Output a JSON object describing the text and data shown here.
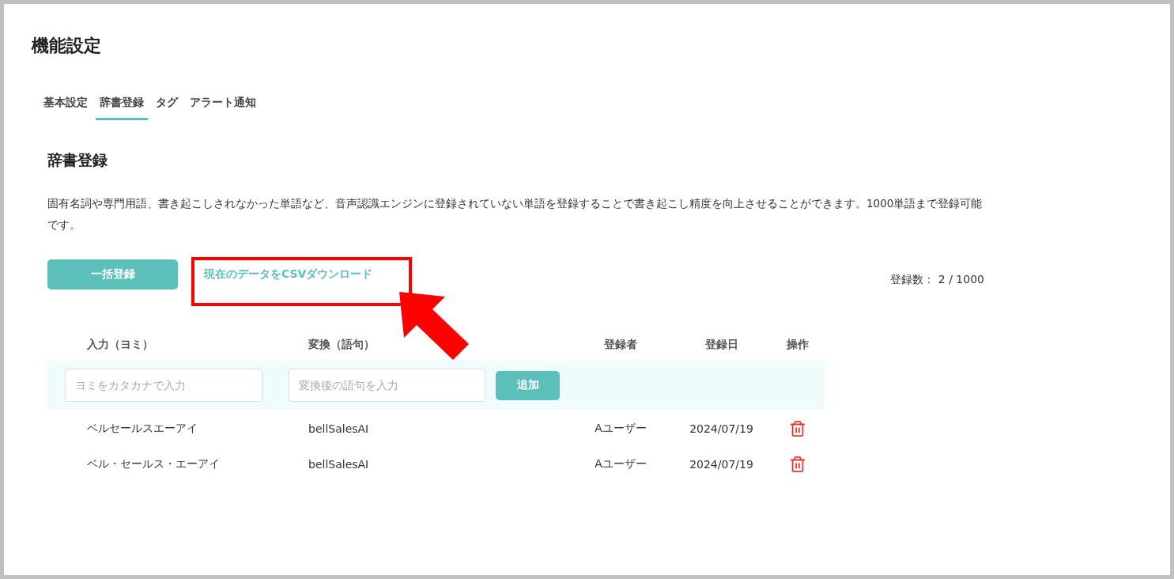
{
  "page": {
    "title": "機能設定"
  },
  "tabs": [
    {
      "label": "基本設定",
      "selected": false
    },
    {
      "label": "辞書登録",
      "selected": true
    },
    {
      "label": "タグ",
      "selected": false
    },
    {
      "label": "アラート通知",
      "selected": false
    }
  ],
  "section": {
    "heading": "辞書登録",
    "description": "固有名詞や専門用語、書き起こしされなかった単語など、音声認識エンジンに登録されていない単語を登録することで書き起こし精度を向上させることができます。1000単語まで登録可能です。"
  },
  "actions": {
    "bulk_button": "一括登録",
    "download_link": "現在のデータをCSVダウンロード",
    "count": "登録数： 2 / 1000"
  },
  "table": {
    "columns": [
      "入力（ヨミ）",
      "変換（語句）",
      "登録者",
      "登録日",
      "操作"
    ],
    "new_entry": {
      "reading_placeholder": "ヨミをカタカナで入力",
      "phrase_placeholder": "変換後の語句を入力",
      "add_button": "追加"
    },
    "rows": [
      {
        "reading": "ベルセールスエーアイ",
        "phrase": "bellSalesAI",
        "user": "Aユーザー",
        "date": "2024/07/19"
      },
      {
        "reading": "ベル・セールス・エーアイ",
        "phrase": "bellSalesAI",
        "user": "Aユーザー",
        "date": "2024/07/19"
      }
    ]
  }
}
